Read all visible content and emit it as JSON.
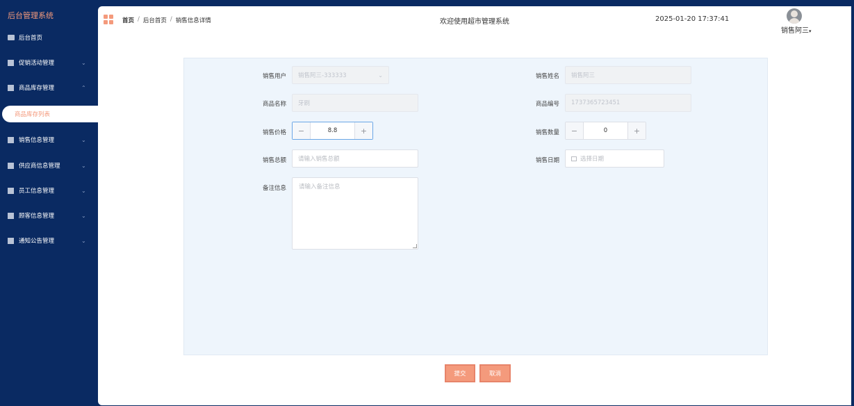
{
  "sidebar": {
    "brand": "后台管理系统",
    "items": [
      {
        "label": "后台首页",
        "icon": "monitor-icon",
        "has_children": false
      },
      {
        "label": "促销活动管理",
        "icon": "checkbox-icon",
        "has_children": true,
        "chevron": "⌄"
      },
      {
        "label": "商品库存管理",
        "icon": "checkbox-icon",
        "has_children": true,
        "chevron": "⌃"
      },
      {
        "label": "销售信息管理",
        "icon": "checkbox-icon",
        "has_children": true,
        "chevron": "⌄"
      },
      {
        "label": "供应商信息管理",
        "icon": "checkbox-icon",
        "has_children": true,
        "chevron": "⌄"
      },
      {
        "label": "员工信息管理",
        "icon": "checkbox-icon",
        "has_children": true,
        "chevron": "⌄"
      },
      {
        "label": "顾客信息管理",
        "icon": "checkbox-icon",
        "has_children": true,
        "chevron": "⌄"
      },
      {
        "label": "通知公告管理",
        "icon": "checkbox-icon",
        "has_children": true,
        "chevron": "⌄"
      }
    ],
    "active_sub": "商品库存列表"
  },
  "header": {
    "breadcrumb": [
      "首页",
      "后台首页",
      "销售信息详情"
    ],
    "separator": "/",
    "welcome": "欢迎使用超市管理系统",
    "datetime": "2025-01-20 17:37:41",
    "username": "销售阿三",
    "caret": "▾"
  },
  "form": {
    "sale_user": {
      "label": "销售用户",
      "value": "销售阿三-333333",
      "arrow": "⌄"
    },
    "sale_name": {
      "label": "销售姓名",
      "value": "销售阿三"
    },
    "product_name": {
      "label": "商品名称",
      "value": "牙刷"
    },
    "product_code": {
      "label": "商品编号",
      "value": "1737365723451"
    },
    "sale_price": {
      "label": "销售价格",
      "value": "8.8",
      "minus": "−",
      "plus": "+"
    },
    "sale_qty": {
      "label": "销售数量",
      "value": "0",
      "minus": "−",
      "plus": "+"
    },
    "sale_total": {
      "label": "销售总额",
      "placeholder": "请输入销售总额"
    },
    "sale_date": {
      "label": "销售日期",
      "placeholder": "选择日期"
    },
    "remark": {
      "label": "备注信息",
      "placeholder": "请输入备注信息"
    }
  },
  "actions": {
    "submit": "提交",
    "cancel": "取消"
  },
  "colors": {
    "sidebar_bg": "#0a2a62",
    "accent": "#f49a7c",
    "panel_bg": "#eef5fc"
  }
}
